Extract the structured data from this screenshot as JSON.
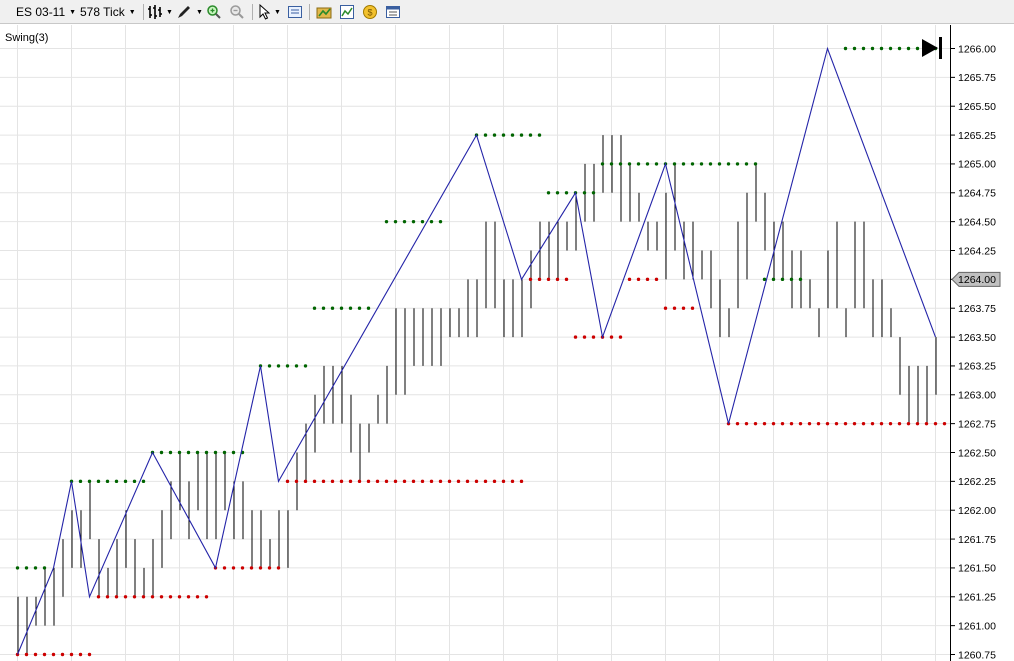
{
  "toolbar": {
    "instrument": "ES 03-11",
    "interval": "578 Tick",
    "icons": [
      "bar-type-icon",
      "draw-tool-icon",
      "zoom-in-icon",
      "zoom-out-icon",
      "pointer-icon",
      "data-box-icon",
      "instruments-icon",
      "indicators-icon",
      "strategies-icon",
      "properties-icon"
    ]
  },
  "chart": {
    "indicator_label": "Swing(3)",
    "current_price_label": "1264.00",
    "colors": {
      "background": "#ffffff",
      "grid": "#e4e4e4",
      "bars": "#000000",
      "zigzag": "#2424a8",
      "swing_high": "#006400",
      "swing_low": "#cc0000",
      "price_marker": "#c0c0c0"
    }
  },
  "chart_data": {
    "type": "ohlc-bar",
    "ylim": [
      1260.75,
      1266.0
    ],
    "y_ticks": [
      "1260.75",
      "1261.00",
      "1261.25",
      "1261.50",
      "1261.75",
      "1262.00",
      "1262.25",
      "1262.50",
      "1262.75",
      "1263.00",
      "1263.25",
      "1263.50",
      "1263.75",
      "1264.00",
      "1264.25",
      "1264.50",
      "1264.75",
      "1265.00",
      "1265.25",
      "1265.50",
      "1265.75",
      "1266.00"
    ],
    "bar_count": 103,
    "bars": [
      [
        1261.25,
        1260.75
      ],
      [
        1261.25,
        1260.75
      ],
      [
        1261.25,
        1261.0
      ],
      [
        1261.5,
        1261.0
      ],
      [
        1261.5,
        1261.0
      ],
      [
        1261.75,
        1261.25
      ],
      [
        1262.0,
        1261.5
      ],
      [
        1262.0,
        1261.5
      ],
      [
        1262.25,
        1261.75
      ],
      [
        1261.75,
        1261.25
      ],
      [
        1261.5,
        1261.25
      ],
      [
        1261.75,
        1261.25
      ],
      [
        1262.0,
        1261.5
      ],
      [
        1261.75,
        1261.25
      ],
      [
        1261.5,
        1261.25
      ],
      [
        1261.75,
        1261.25
      ],
      [
        1262.0,
        1261.5
      ],
      [
        1262.25,
        1261.75
      ],
      [
        1262.5,
        1262.0
      ],
      [
        1262.25,
        1261.75
      ],
      [
        1262.5,
        1262.0
      ],
      [
        1262.5,
        1261.75
      ],
      [
        1262.5,
        1261.75
      ],
      [
        1262.5,
        1262.0
      ],
      [
        1262.25,
        1261.75
      ],
      [
        1262.25,
        1261.75
      ],
      [
        1262.0,
        1261.5
      ],
      [
        1262.0,
        1261.5
      ],
      [
        1261.75,
        1261.5
      ],
      [
        1262.0,
        1261.5
      ],
      [
        1262.0,
        1261.5
      ],
      [
        1262.5,
        1262.0
      ],
      [
        1262.75,
        1262.25
      ],
      [
        1263.0,
        1262.5
      ],
      [
        1263.25,
        1262.75
      ],
      [
        1263.25,
        1262.75
      ],
      [
        1263.25,
        1262.75
      ],
      [
        1263.0,
        1262.5
      ],
      [
        1262.75,
        1262.25
      ],
      [
        1262.75,
        1262.5
      ],
      [
        1263.0,
        1262.75
      ],
      [
        1263.25,
        1262.75
      ],
      [
        1263.75,
        1263.0
      ],
      [
        1263.75,
        1263.0
      ],
      [
        1263.75,
        1263.25
      ],
      [
        1263.75,
        1263.25
      ],
      [
        1263.75,
        1263.25
      ],
      [
        1263.75,
        1263.25
      ],
      [
        1263.75,
        1263.5
      ],
      [
        1263.75,
        1263.5
      ],
      [
        1264.0,
        1263.5
      ],
      [
        1264.0,
        1263.5
      ],
      [
        1264.5,
        1263.75
      ],
      [
        1264.5,
        1263.75
      ],
      [
        1264.0,
        1263.5
      ],
      [
        1264.0,
        1263.5
      ],
      [
        1264.0,
        1263.5
      ],
      [
        1264.25,
        1263.75
      ],
      [
        1264.5,
        1264.0
      ],
      [
        1264.5,
        1264.0
      ],
      [
        1264.5,
        1264.0
      ],
      [
        1264.5,
        1264.25
      ],
      [
        1264.75,
        1264.25
      ],
      [
        1265.0,
        1264.5
      ],
      [
        1265.0,
        1264.5
      ],
      [
        1265.25,
        1264.75
      ],
      [
        1265.25,
        1264.75
      ],
      [
        1265.25,
        1264.5
      ],
      [
        1265.0,
        1264.5
      ],
      [
        1264.75,
        1264.5
      ],
      [
        1264.5,
        1264.25
      ],
      [
        1264.5,
        1264.25
      ],
      [
        1264.75,
        1264.0
      ],
      [
        1265.0,
        1264.25
      ],
      [
        1264.5,
        1264.0
      ],
      [
        1264.5,
        1264.0
      ],
      [
        1264.25,
        1264.0
      ],
      [
        1264.25,
        1263.75
      ],
      [
        1264.0,
        1263.5
      ],
      [
        1263.75,
        1263.5
      ],
      [
        1264.5,
        1263.75
      ],
      [
        1264.75,
        1264.0
      ],
      [
        1265.0,
        1264.5
      ],
      [
        1264.75,
        1264.25
      ],
      [
        1264.5,
        1264.0
      ],
      [
        1264.5,
        1264.0
      ],
      [
        1264.25,
        1263.75
      ],
      [
        1264.25,
        1263.75
      ],
      [
        1264.0,
        1263.75
      ],
      [
        1263.75,
        1263.5
      ],
      [
        1264.25,
        1263.75
      ],
      [
        1264.5,
        1263.75
      ],
      [
        1263.75,
        1263.5
      ],
      [
        1264.5,
        1263.75
      ],
      [
        1264.5,
        1263.75
      ],
      [
        1264.0,
        1263.5
      ],
      [
        1264.0,
        1263.5
      ],
      [
        1263.75,
        1263.5
      ],
      [
        1263.5,
        1263.0
      ],
      [
        1263.25,
        1262.75
      ],
      [
        1263.25,
        1262.75
      ],
      [
        1263.25,
        1262.75
      ],
      [
        1263.5,
        1263.0
      ]
    ],
    "zigzag_points": [
      [
        1,
        1260.75
      ],
      [
        5,
        1261.5
      ],
      [
        7,
        1262.25
      ],
      [
        9,
        1261.25
      ],
      [
        16,
        1262.5
      ],
      [
        23,
        1261.5
      ],
      [
        28,
        1263.25
      ],
      [
        30,
        1262.25
      ],
      [
        52,
        1265.25
      ],
      [
        57,
        1264.0
      ],
      [
        63,
        1264.75
      ],
      [
        66,
        1263.5
      ],
      [
        73,
        1265.0
      ],
      [
        80,
        1262.75
      ],
      [
        91,
        1266.0
      ],
      [
        103,
        1263.5
      ]
    ],
    "swing_highs": [
      {
        "value": 1261.5,
        "from": 1,
        "to": 4
      },
      {
        "value": 1262.25,
        "from": 7,
        "to": 15
      },
      {
        "value": 1262.5,
        "from": 16,
        "to": 26
      },
      {
        "value": 1263.25,
        "from": 28,
        "to": 33
      },
      {
        "value": 1263.75,
        "from": 34,
        "to": 40
      },
      {
        "value": 1264.5,
        "from": 42,
        "to": 48
      },
      {
        "value": 1265.25,
        "from": 52,
        "to": 59
      },
      {
        "value": 1264.75,
        "from": 60,
        "to": 65
      },
      {
        "value": 1265.0,
        "from": 66,
        "to": 83
      },
      {
        "value": 1264.0,
        "from": 84,
        "to": 88
      },
      {
        "value": 1266.0,
        "from": 93,
        "to": 103
      }
    ],
    "swing_lows": [
      {
        "value": 1260.75,
        "from": 1,
        "to": 9
      },
      {
        "value": 1261.25,
        "from": 10,
        "to": 22
      },
      {
        "value": 1261.5,
        "from": 23,
        "to": 30
      },
      {
        "value": 1262.25,
        "from": 31,
        "to": 57
      },
      {
        "value": 1264.0,
        "from": 58,
        "to": 62
      },
      {
        "value": 1263.5,
        "from": 63,
        "to": 68
      },
      {
        "value": 1264.0,
        "from": 69,
        "to": 72
      },
      {
        "value": 1263.75,
        "from": 73,
        "to": 76
      },
      {
        "value": 1262.75,
        "from": 80,
        "to": 104
      },
      {
        "value": 1263.5,
        "from": 105,
        "to": 105
      }
    ],
    "current_price": 1264.0,
    "grid": true
  }
}
